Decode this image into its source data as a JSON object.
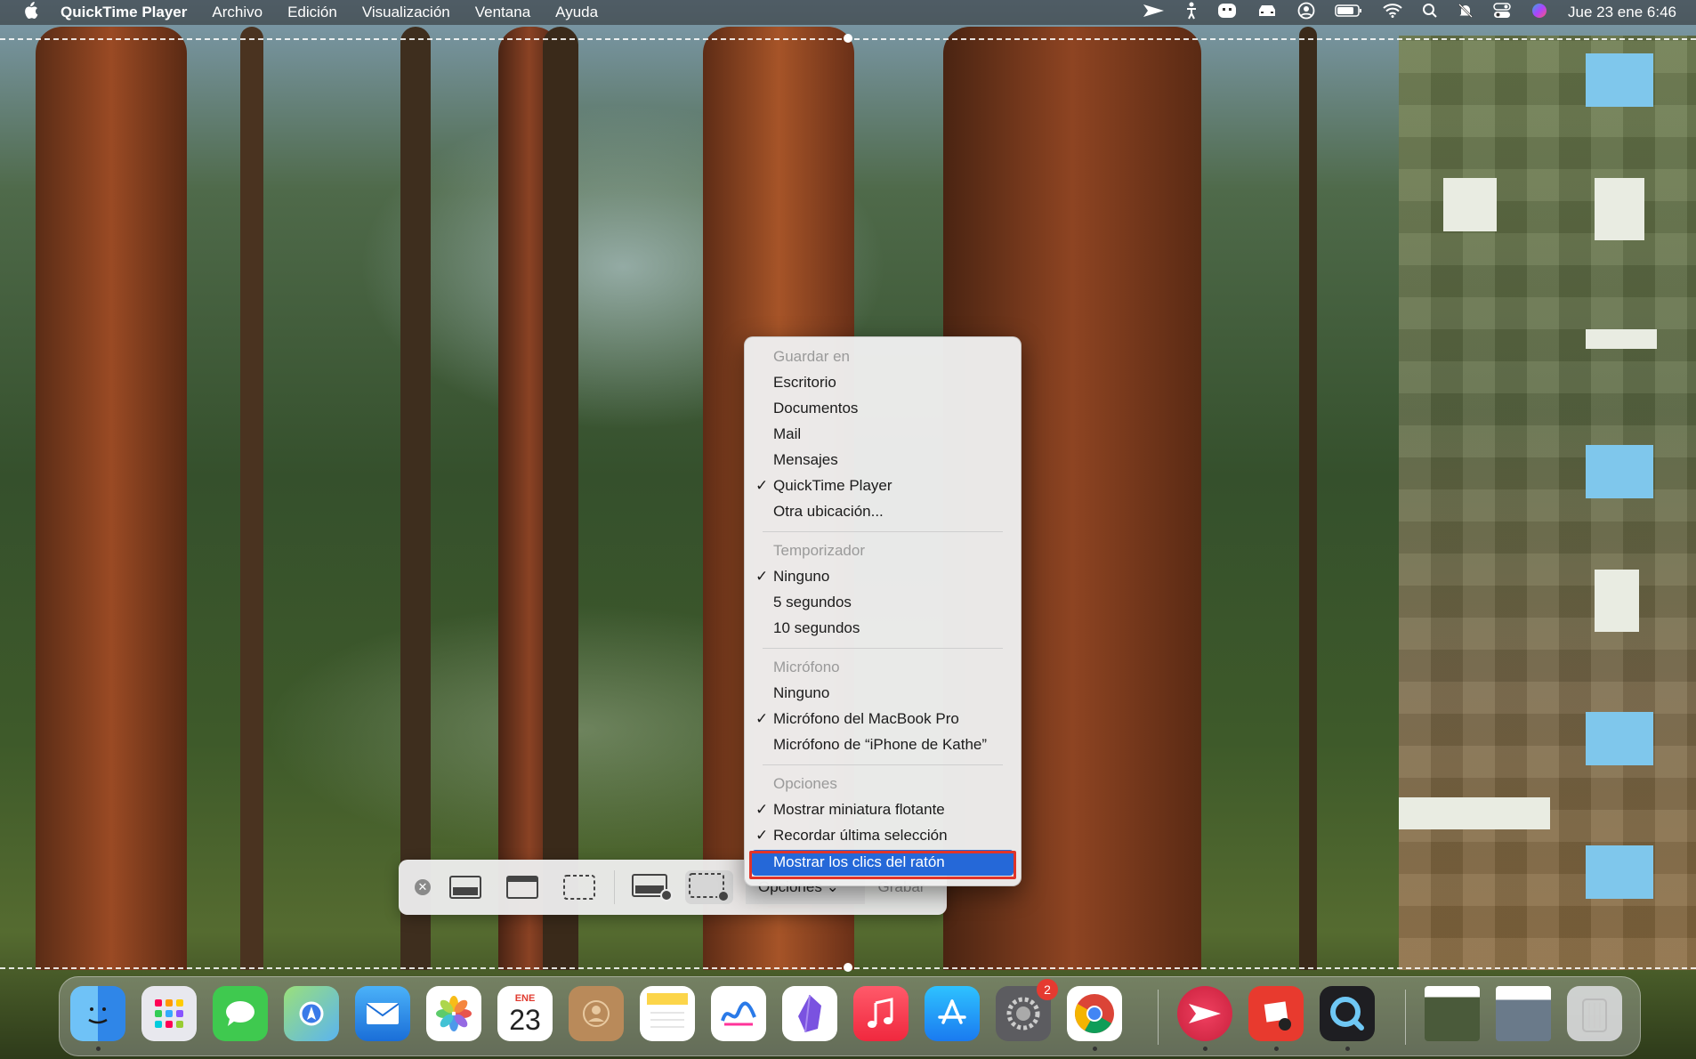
{
  "menubar": {
    "app_name": "QuickTime Player",
    "menus": [
      "Archivo",
      "Edición",
      "Visualización",
      "Ventana",
      "Ayuda"
    ],
    "clock": "Jue 23 ene 6:46"
  },
  "toolbar": {
    "options_label": "Opciones",
    "options_chevron": "⌄",
    "record_label": "Grabar"
  },
  "dropdown": {
    "sections": [
      {
        "header": "Guardar en",
        "items": [
          {
            "label": "Escritorio",
            "checked": false
          },
          {
            "label": "Documentos",
            "checked": false
          },
          {
            "label": "Mail",
            "checked": false
          },
          {
            "label": "Mensajes",
            "checked": false
          },
          {
            "label": "QuickTime Player",
            "checked": true
          },
          {
            "label": "Otra ubicación...",
            "checked": false
          }
        ]
      },
      {
        "header": "Temporizador",
        "items": [
          {
            "label": "Ninguno",
            "checked": true
          },
          {
            "label": "5 segundos",
            "checked": false
          },
          {
            "label": "10 segundos",
            "checked": false
          }
        ]
      },
      {
        "header": "Micrófono",
        "items": [
          {
            "label": "Ninguno",
            "checked": false
          },
          {
            "label": "Micrófono del MacBook Pro",
            "checked": true
          },
          {
            "label": "Micrófono de “iPhone de Kathe”",
            "checked": false
          }
        ]
      },
      {
        "header": "Opciones",
        "items": [
          {
            "label": "Mostrar miniatura flotante",
            "checked": true
          },
          {
            "label": "Recordar última selección",
            "checked": true
          },
          {
            "label": "Mostrar los clics del ratón",
            "checked": false,
            "highlighted": true
          }
        ]
      }
    ],
    "check_mark": "✓"
  },
  "dock": {
    "calendar_month": "ENE",
    "calendar_day": "23",
    "settings_badge": "2"
  },
  "colors": {
    "highlight": "#2568d8",
    "annotation_border": "#e0342a"
  }
}
